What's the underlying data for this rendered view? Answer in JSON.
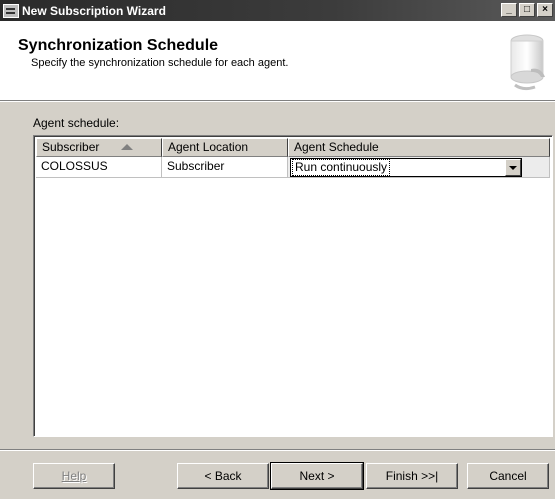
{
  "window": {
    "title": "New Subscription Wizard",
    "controls": {
      "minimize": "_",
      "maximize": "□",
      "close": "×"
    }
  },
  "header": {
    "title": "Synchronization Schedule",
    "subtitle": "Specify the synchronization schedule for each agent."
  },
  "agent_schedule": {
    "label": "Agent schedule:",
    "columns": [
      "Subscriber",
      "Agent Location",
      "Agent Schedule"
    ],
    "rows": [
      {
        "subscriber": "COLOSSUS",
        "location": "Subscriber",
        "schedule": "Run continuously"
      }
    ]
  },
  "buttons": {
    "help": "Help",
    "back": "< Back",
    "next": "Next >",
    "finish": "Finish >>|",
    "cancel": "Cancel"
  }
}
